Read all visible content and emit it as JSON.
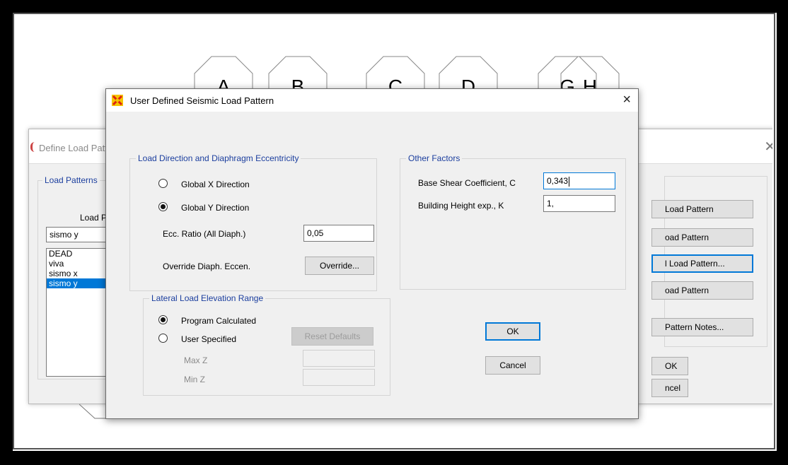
{
  "grid_bubbles": [
    "A",
    "B",
    "C",
    "D",
    "G",
    "H"
  ],
  "bg_window": {
    "title": "Define Load Pattern",
    "group_label": "Load Patterns",
    "column_header": "Load Pattern",
    "name_value": "sismo y",
    "list_items": [
      "DEAD",
      "viva",
      "sismo x",
      "sismo y"
    ],
    "selected_item": "sismo y",
    "buttons": [
      "Load Pattern",
      "oad Pattern",
      "l Load Pattern...",
      "oad Pattern",
      "Pattern Notes..."
    ],
    "ok_label": "OK",
    "cancel_label": "ncel"
  },
  "dialog": {
    "title": "User Defined Seismic Load Pattern",
    "close": "×",
    "direction_group": {
      "label": "Load Direction and Diaphragm Eccentricity",
      "global_x": "Global  X  Direction",
      "global_y": "Global  Y  Direction",
      "selected": "global_y",
      "ecc_label": "Ecc. Ratio (All Diaph.)",
      "ecc_value": "0,05",
      "override_label": "Override Diaph. Eccen.",
      "override_button": "Override..."
    },
    "other_factors": {
      "label": "Other Factors",
      "base_shear_label": "Base Shear Coefficient, C",
      "base_shear_value": "0,343",
      "height_exp_label": "Building Height exp., K",
      "height_exp_value": "1,"
    },
    "elevation_group": {
      "label": "Lateral Load Elevation Range",
      "program_calculated": "Program Calculated",
      "user_specified": "User Specified",
      "selected": "program_calculated",
      "reset_defaults": "Reset Defaults",
      "max_z_label": "Max Z",
      "min_z_label": "Min Z",
      "max_z_value": "",
      "min_z_value": ""
    },
    "ok_label": "OK",
    "cancel_label": "Cancel"
  },
  "colors": {
    "accent": "#0078d7",
    "group_label": "#1b3e9e",
    "selection": "#0078d7"
  }
}
